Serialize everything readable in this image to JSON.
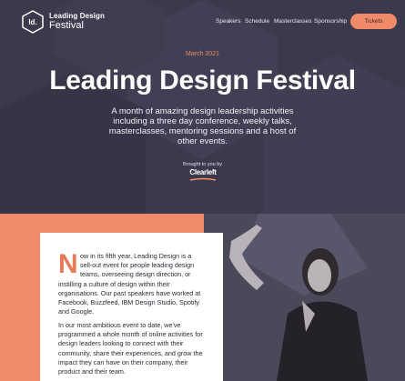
{
  "header": {
    "logo_mark": "ld.",
    "logo_title": "Leading Design",
    "logo_subtitle": "Festival",
    "nav": [
      "Speakers",
      "Schedule",
      "Masterclasses",
      "Sponsorship"
    ],
    "cta_label": "Tickets"
  },
  "hero": {
    "date": "March 2021",
    "title": "Leading Design Festival",
    "intro": "A month of amazing design leadership activities including a three day conference, weekly talks, masterclasses, mentoring sessions and a host of other events.",
    "brought_by": "Brought to you by",
    "sponsor": "Clearleft"
  },
  "content": {
    "dropcap": "N",
    "para1_lines": [
      "ow in its fifth year, Leading Design is a",
      "sell-out event for people leading design",
      "teams, overseeing design direction, or"
    ],
    "para1_rest": "instilling a culture of design within their organisations. Our past speakers have worked at Facebook, Buzzfeed, IBM Design Studio, Spotify and Google.",
    "para2": "In our most ambitious event to date, we've programmed a whole month of online activities for design leaders looking to connect with their community, share their experiences, and grow the impact they can have on their company, their product and their team."
  },
  "colors": {
    "background": "#3a3949",
    "accent": "#f08a68",
    "card": "#ffffff"
  },
  "icons": {
    "logo": "hexagon-logo-icon",
    "sponsor_mark": "clearleft-swoosh-icon"
  }
}
